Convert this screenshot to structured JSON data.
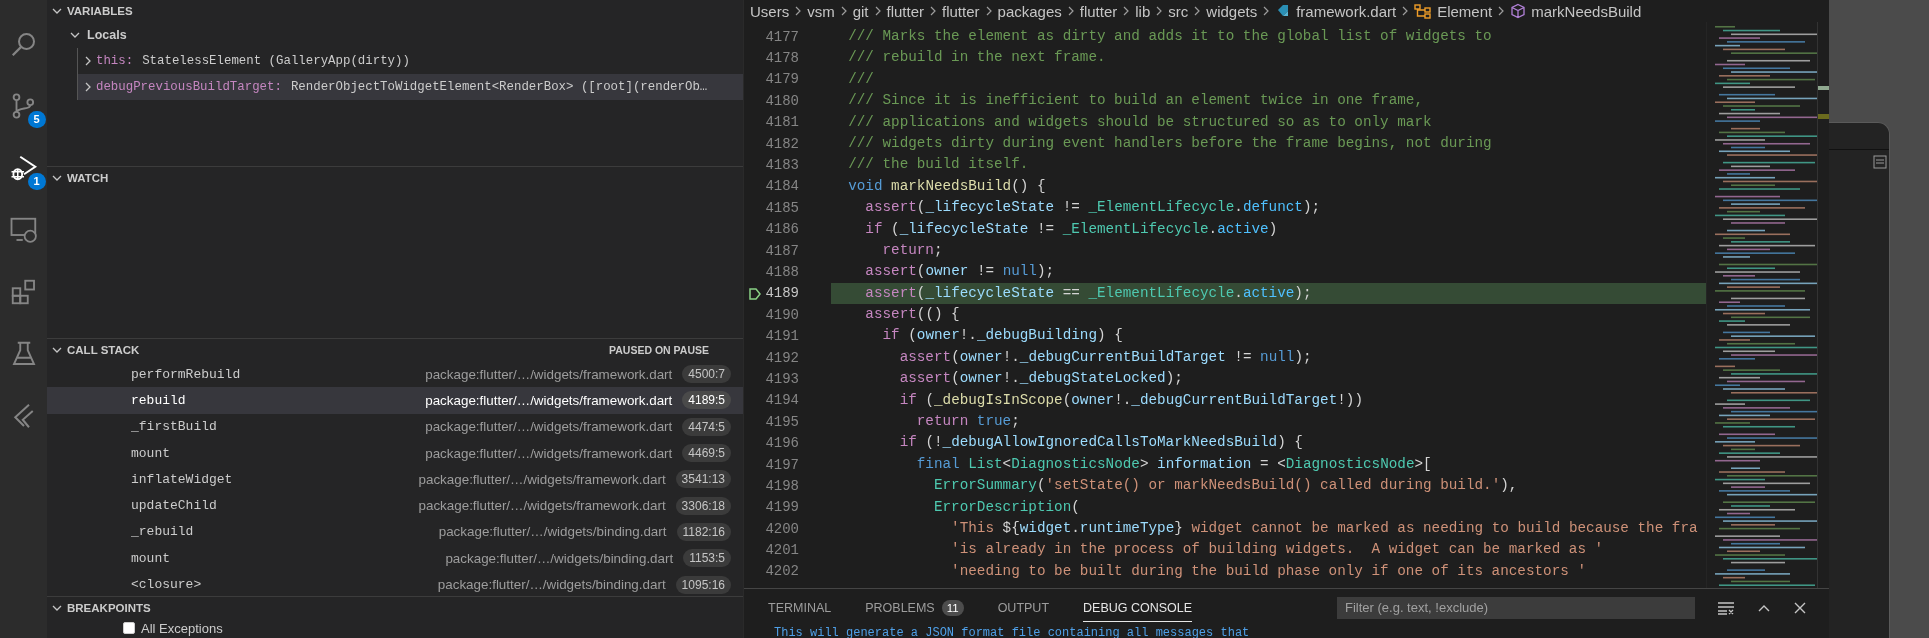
{
  "activity_bar": [
    {
      "selected": false
    },
    {
      "selected": false,
      "badge": "5"
    },
    {
      "selected": true,
      "badge": "1"
    },
    {
      "selected": false
    },
    {
      "selected": false
    },
    {
      "selected": false
    },
    {
      "selected": false
    }
  ],
  "variables": {
    "title": "VARIABLES",
    "expanded": true,
    "scopes": [
      {
        "label": "Locals",
        "expanded": true,
        "children": [
          {
            "name": "this:",
            "value": "StatelessElement (GalleryApp(dirty))",
            "expanded": false,
            "selected": false
          },
          {
            "name": "debugPreviousBuildTarget:",
            "value": "RenderObjectToWidgetElement<RenderBox> ([root](renderOb…",
            "expanded": false,
            "selected": true
          }
        ]
      }
    ]
  },
  "watch": {
    "title": "WATCH",
    "expanded": true
  },
  "call_stack": {
    "title": "CALL STACK",
    "expanded": true,
    "status": "PAUSED ON PAUSE",
    "frames": [
      {
        "name": "performRebuild",
        "source": "package:flutter/…/widgets/framework.dart",
        "position": "4500:7",
        "selected": false
      },
      {
        "name": "rebuild",
        "source": "package:flutter/…/widgets/framework.dart",
        "position": "4189:5",
        "selected": true
      },
      {
        "name": "_firstBuild",
        "source": "package:flutter/…/widgets/framework.dart",
        "position": "4474:5",
        "selected": false
      },
      {
        "name": "mount",
        "source": "package:flutter/…/widgets/framework.dart",
        "position": "4469:5",
        "selected": false
      },
      {
        "name": "inflateWidget",
        "source": "package:flutter/…/widgets/framework.dart",
        "position": "3541:13",
        "selected": false
      },
      {
        "name": "updateChild",
        "source": "package:flutter/…/widgets/framework.dart",
        "position": "3306:18",
        "selected": false
      },
      {
        "name": "_rebuild",
        "source": "package:flutter/…/widgets/binding.dart",
        "position": "1182:16",
        "selected": false
      },
      {
        "name": "mount",
        "source": "package:flutter/…/widgets/binding.dart",
        "position": "1153:5",
        "selected": false
      },
      {
        "name": "<closure>",
        "source": "package:flutter/…/widgets/binding.dart",
        "position": "1095:16",
        "selected": false
      }
    ]
  },
  "breakpoints": {
    "title": "BREAKPOINTS",
    "expanded": true,
    "items": [
      {
        "label": "All Exceptions",
        "checked": false
      }
    ]
  },
  "breadcrumbs": [
    {
      "label": "Users",
      "kind": "folder"
    },
    {
      "label": "vsm",
      "kind": "folder"
    },
    {
      "label": "git",
      "kind": "folder"
    },
    {
      "label": "flutter",
      "kind": "folder"
    },
    {
      "label": "flutter",
      "kind": "folder"
    },
    {
      "label": "packages",
      "kind": "folder"
    },
    {
      "label": "flutter",
      "kind": "folder"
    },
    {
      "label": "lib",
      "kind": "folder"
    },
    {
      "label": "src",
      "kind": "folder"
    },
    {
      "label": "widgets",
      "kind": "folder"
    },
    {
      "label": "framework.dart",
      "kind": "file"
    },
    {
      "label": "Element",
      "kind": "class"
    },
    {
      "label": "markNeedsBuild",
      "kind": "method"
    }
  ],
  "code": {
    "lines": [
      {
        "number": "4177",
        "paused": false,
        "tokens": [
          {
            "kind": "comment",
            "text": "  /// Marks the element as dirty and adds it to the global list of widgets to"
          }
        ]
      },
      {
        "number": "4178",
        "paused": false,
        "tokens": [
          {
            "kind": "comment",
            "text": "  /// rebuild in the next frame."
          }
        ]
      },
      {
        "number": "4179",
        "paused": false,
        "tokens": [
          {
            "kind": "comment",
            "text": "  ///"
          }
        ]
      },
      {
        "number": "4180",
        "paused": false,
        "tokens": [
          {
            "kind": "comment",
            "text": "  /// Since it is inefficient to build an element twice in one frame,"
          }
        ]
      },
      {
        "number": "4181",
        "paused": false,
        "tokens": [
          {
            "kind": "comment",
            "text": "  /// applications and widgets should be structured so as to only mark"
          }
        ]
      },
      {
        "number": "4182",
        "paused": false,
        "tokens": [
          {
            "kind": "comment",
            "text": "  /// widgets dirty during event handlers before the frame begins, not during"
          }
        ]
      },
      {
        "number": "4183",
        "paused": false,
        "tokens": [
          {
            "kind": "comment",
            "text": "  /// the build itself."
          }
        ]
      },
      {
        "number": "4184",
        "paused": false,
        "tokens": [
          {
            "kind": "keyword",
            "text": "  void"
          },
          {
            "kind": "function",
            "text": " markNeedsBuild"
          },
          {
            "kind": "plain",
            "text": "() {"
          }
        ]
      },
      {
        "number": "4185",
        "paused": false,
        "tokens": [
          {
            "kind": "control",
            "text": "    assert"
          },
          {
            "kind": "plain",
            "text": "("
          },
          {
            "kind": "variable",
            "text": "_lifecycleState"
          },
          {
            "kind": "plain",
            "text": " != "
          },
          {
            "kind": "type",
            "text": "_ElementLifecycle"
          },
          {
            "kind": "plain",
            "text": "."
          },
          {
            "kind": "constant",
            "text": "defunct"
          },
          {
            "kind": "plain",
            "text": ");"
          }
        ]
      },
      {
        "number": "4186",
        "paused": false,
        "tokens": [
          {
            "kind": "control",
            "text": "    if"
          },
          {
            "kind": "plain",
            "text": " ("
          },
          {
            "kind": "variable",
            "text": "_lifecycleState"
          },
          {
            "kind": "plain",
            "text": " != "
          },
          {
            "kind": "type",
            "text": "_ElementLifecycle"
          },
          {
            "kind": "plain",
            "text": "."
          },
          {
            "kind": "constant",
            "text": "active"
          },
          {
            "kind": "plain",
            "text": ")"
          }
        ]
      },
      {
        "number": "4187",
        "paused": false,
        "tokens": [
          {
            "kind": "control",
            "text": "      return"
          },
          {
            "kind": "plain",
            "text": ";"
          }
        ]
      },
      {
        "number": "4188",
        "paused": false,
        "tokens": [
          {
            "kind": "control",
            "text": "    assert"
          },
          {
            "kind": "plain",
            "text": "("
          },
          {
            "kind": "variable",
            "text": "owner"
          },
          {
            "kind": "plain",
            "text": " != "
          },
          {
            "kind": "keyword",
            "text": "null"
          },
          {
            "kind": "plain",
            "text": ");"
          }
        ]
      },
      {
        "number": "4189",
        "paused": true,
        "tokens": [
          {
            "kind": "control",
            "text": "    assert"
          },
          {
            "kind": "plain",
            "text": "("
          },
          {
            "kind": "variable",
            "text": "_lifecycleState"
          },
          {
            "kind": "plain",
            "text": " == "
          },
          {
            "kind": "type",
            "text": "_ElementLifecycle"
          },
          {
            "kind": "plain",
            "text": "."
          },
          {
            "kind": "constant",
            "text": "active"
          },
          {
            "kind": "plain",
            "text": ");"
          }
        ]
      },
      {
        "number": "4190",
        "paused": false,
        "tokens": [
          {
            "kind": "control",
            "text": "    assert"
          },
          {
            "kind": "plain",
            "text": "(() {"
          }
        ]
      },
      {
        "number": "4191",
        "paused": false,
        "tokens": [
          {
            "kind": "control",
            "text": "      if"
          },
          {
            "kind": "plain",
            "text": " ("
          },
          {
            "kind": "variable",
            "text": "owner"
          },
          {
            "kind": "plain",
            "text": "!."
          },
          {
            "kind": "variable",
            "text": "_debugBuilding"
          },
          {
            "kind": "plain",
            "text": ") {"
          }
        ]
      },
      {
        "number": "4192",
        "paused": false,
        "tokens": [
          {
            "kind": "control",
            "text": "        assert"
          },
          {
            "kind": "plain",
            "text": "("
          },
          {
            "kind": "variable",
            "text": "owner"
          },
          {
            "kind": "plain",
            "text": "!."
          },
          {
            "kind": "variable",
            "text": "_debugCurrentBuildTarget"
          },
          {
            "kind": "plain",
            "text": " != "
          },
          {
            "kind": "keyword",
            "text": "null"
          },
          {
            "kind": "plain",
            "text": ");"
          }
        ]
      },
      {
        "number": "4193",
        "paused": false,
        "tokens": [
          {
            "kind": "control",
            "text": "        assert"
          },
          {
            "kind": "plain",
            "text": "("
          },
          {
            "kind": "variable",
            "text": "owner"
          },
          {
            "kind": "plain",
            "text": "!."
          },
          {
            "kind": "variable",
            "text": "_debugStateLocked"
          },
          {
            "kind": "plain",
            "text": ");"
          }
        ]
      },
      {
        "number": "4194",
        "paused": false,
        "tokens": [
          {
            "kind": "control",
            "text": "        if"
          },
          {
            "kind": "plain",
            "text": " ("
          },
          {
            "kind": "function",
            "text": "_debugIsInScope"
          },
          {
            "kind": "plain",
            "text": "("
          },
          {
            "kind": "variable",
            "text": "owner"
          },
          {
            "kind": "plain",
            "text": "!."
          },
          {
            "kind": "variable",
            "text": "_debugCurrentBuildTarget"
          },
          {
            "kind": "plain",
            "text": "!))"
          }
        ]
      },
      {
        "number": "4195",
        "paused": false,
        "tokens": [
          {
            "kind": "control",
            "text": "          return"
          },
          {
            "kind": "keyword",
            "text": " true"
          },
          {
            "kind": "plain",
            "text": ";"
          }
        ]
      },
      {
        "number": "4196",
        "paused": false,
        "tokens": [
          {
            "kind": "control",
            "text": "        if"
          },
          {
            "kind": "plain",
            "text": " (!"
          },
          {
            "kind": "variable",
            "text": "_debugAllowIgnoredCallsToMarkNeedsBuild"
          },
          {
            "kind": "plain",
            "text": ") {"
          }
        ]
      },
      {
        "number": "4197",
        "paused": false,
        "tokens": [
          {
            "kind": "keyword",
            "text": "          final"
          },
          {
            "kind": "type",
            "text": " List"
          },
          {
            "kind": "plain",
            "text": "<"
          },
          {
            "kind": "type",
            "text": "DiagnosticsNode"
          },
          {
            "kind": "plain",
            "text": "> "
          },
          {
            "kind": "variable",
            "text": "information"
          },
          {
            "kind": "plain",
            "text": " = <"
          },
          {
            "kind": "type",
            "text": "DiagnosticsNode"
          },
          {
            "kind": "plain",
            "text": ">["
          }
        ]
      },
      {
        "number": "4198",
        "paused": false,
        "tokens": [
          {
            "kind": "type",
            "text": "            ErrorSummary"
          },
          {
            "kind": "plain",
            "text": "("
          },
          {
            "kind": "string",
            "text": "'setState() or markNeedsBuild() called during build.'"
          },
          {
            "kind": "plain",
            "text": "),"
          }
        ]
      },
      {
        "number": "4199",
        "paused": false,
        "tokens": [
          {
            "kind": "type",
            "text": "            ErrorDescription"
          },
          {
            "kind": "plain",
            "text": "("
          }
        ]
      },
      {
        "number": "4200",
        "paused": false,
        "tokens": [
          {
            "kind": "string",
            "text": "              'This "
          },
          {
            "kind": "plain",
            "text": "${"
          },
          {
            "kind": "variable",
            "text": "widget"
          },
          {
            "kind": "plain",
            "text": "."
          },
          {
            "kind": "variable",
            "text": "runtimeType"
          },
          {
            "kind": "plain",
            "text": "}"
          },
          {
            "kind": "string",
            "text": " widget cannot be marked as needing to build because the fra"
          }
        ]
      },
      {
        "number": "4201",
        "paused": false,
        "tokens": [
          {
            "kind": "string",
            "text": "              'is already in the process of building widgets.  A widget can be marked as '"
          }
        ]
      },
      {
        "number": "4202",
        "paused": false,
        "tokens": [
          {
            "kind": "string",
            "text": "              'needing to be built during the build phase only if one of its ancestors '"
          }
        ]
      }
    ]
  },
  "panel": {
    "tabs": [
      {
        "label": "TERMINAL",
        "selected": false
      },
      {
        "label": "PROBLEMS",
        "badge": "11",
        "selected": false
      },
      {
        "label": "OUTPUT",
        "selected": false
      },
      {
        "label": "DEBUG CONSOLE",
        "selected": true
      }
    ],
    "filter": {
      "placeholder": "Filter (e.g. text, !exclude)"
    },
    "output": [
      "This will generate a JSON format file containing all messages that"
    ]
  }
}
